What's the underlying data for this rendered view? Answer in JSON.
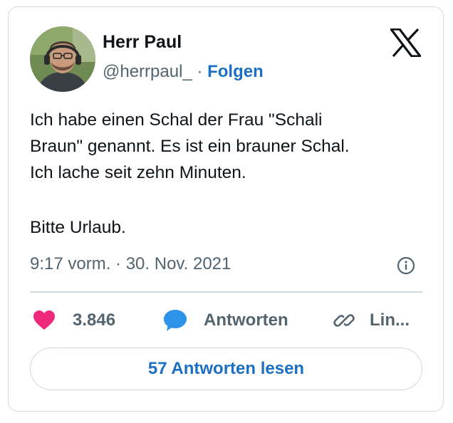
{
  "author": {
    "name": "Herr Paul",
    "handle": "@herrpaul_",
    "separator": "·",
    "follow_label": "Folgen"
  },
  "icons": {
    "brand": "x-logo-icon",
    "info": "info-icon",
    "like": "heart-icon",
    "reply": "speech-bubble-icon",
    "link": "link-icon"
  },
  "tweet": {
    "paragraph_1": "Ich habe einen Schal der Frau \"Schali\nBraun\" genannt. Es ist ein brauner Schal.\nIch lache seit zehn Minuten.",
    "paragraph_2": "Bitte Urlaub.",
    "timestamp": "9:17 vorm. · 30. Nov. 2021"
  },
  "actions": {
    "likes": "3.846",
    "reply_label": "Antworten",
    "link_label": "Lin..."
  },
  "read_replies_label": "57 Antworten lesen",
  "colors": {
    "accent": "#1d6fc4",
    "like": "#f0287b",
    "reply": "#2c93e8",
    "muted": "#536471",
    "border": "#cfd9de"
  }
}
